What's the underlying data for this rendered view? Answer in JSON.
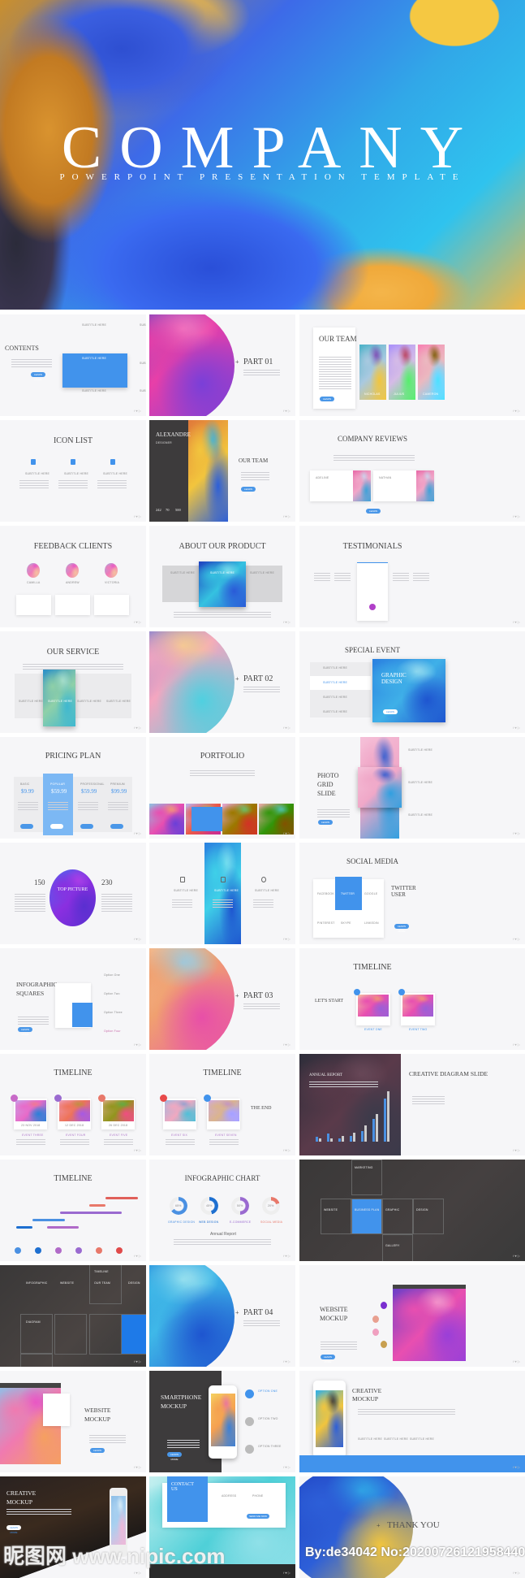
{
  "hero": {
    "title": "COMPANY",
    "subtitle": "POWERPOINT PRESENTATION TEMPLATE"
  },
  "accent": "#4193ec",
  "slides": [
    {
      "title": "CONTENTS",
      "theme": "light",
      "items": [
        "SUBTITLE HERE",
        "SUBTITLE HERE",
        "SUBTITLE HERE",
        "SUBTITLE HERE",
        "SUBTITLE HERE",
        "SUBTITLE HERE"
      ],
      "button": "LEARN MORE"
    },
    {
      "title": "PART 01",
      "theme": "light",
      "palette": [
        "#e83fa8",
        "#7a3fd8",
        "#f27ac2",
        "#3a55d0"
      ]
    },
    {
      "title": "OUR TEAM",
      "theme": "light",
      "items": [
        "NICHOLAS",
        "JULIUS",
        "CAMERON"
      ],
      "button": "LEARN MORE",
      "palette": [
        "#a9c9e0",
        "#f2c53d",
        "#7a3fb0",
        "#4bb2c8"
      ]
    },
    {
      "title": "ICON LIST",
      "theme": "light",
      "items": [
        "SUBTITLE HERE",
        "SUBTITLE HERE",
        "SUBTITLE HERE"
      ]
    },
    {
      "title": "ALEXANDRE",
      "subtitle": "DESIGNER",
      "theme": "light",
      "stats": [
        "242",
        "70",
        "500"
      ],
      "extra": "OUR TEAM",
      "button": "LEARN MORE",
      "palette": [
        "#f2c53d",
        "#2d5fd8",
        "#30b0e8",
        "#e0783a"
      ]
    },
    {
      "title": "COMPANY REVIEWS",
      "theme": "light",
      "items": [
        "ADELINE",
        "NATHAN"
      ],
      "button": "LEARN MORE",
      "palette": [
        "#f0a6c8",
        "#3fa2d8",
        "#c8d8f0",
        "#e86aa8"
      ]
    },
    {
      "title": "FEEDBACK CLIENTS",
      "theme": "light",
      "items": [
        "CAMILLA",
        "ANDREW",
        "VICTORIA"
      ]
    },
    {
      "title": "ABOUT OUR PRODUCT",
      "theme": "light",
      "items": [
        "SUBTITLE HERE",
        "SUBTITLE HERE",
        "SUBTITLE HERE"
      ],
      "palette": [
        "#35c2e0",
        "#2a5ad8",
        "#7fe0ee",
        "#1e40c0"
      ]
    },
    {
      "title": "TESTIMONIALS",
      "theme": "light"
    },
    {
      "title": "OUR SERVICE",
      "theme": "light",
      "items": [
        "SUBTITLE HERE",
        "SUBTITLE HERE",
        "SUBTITLE HERE",
        "SUBTITLE HERE"
      ],
      "palette": [
        "#8fd0a8",
        "#3fb8d0",
        "#a8e0d0",
        "#2a8fc8"
      ]
    },
    {
      "title": "PART 02",
      "theme": "light",
      "palette": [
        "#f4a6c0",
        "#4fd0e0",
        "#f5d08a",
        "#2a6ad8"
      ]
    },
    {
      "title": "SPECIAL EVENT",
      "theme": "light",
      "extra": "GRAPHIC DESIGN",
      "items": [
        "SUBTITLE HERE",
        "SUBTITLE HERE",
        "SUBTITLE HERE",
        "SUBTITLE HERE"
      ],
      "button": "LEARN MORE",
      "palette": [
        "#3fb0e8",
        "#1e55d0",
        "#9fe0f0",
        "#2a80e0"
      ]
    },
    {
      "title": "PRICING PLAN",
      "theme": "light",
      "plans": [
        {
          "name": "BASIC",
          "price": "$9.99"
        },
        {
          "name": "POPULAR",
          "price": "$59.99"
        },
        {
          "name": "PROFESSIONAL",
          "price": "$59.99"
        },
        {
          "name": "PREMIUM",
          "price": "$99.99"
        }
      ]
    },
    {
      "title": "PORTFOLIO",
      "theme": "light",
      "palette": [
        "#e84fb0",
        "#6a3fd8",
        "#f0a070",
        "#8fc0e0"
      ]
    },
    {
      "title": "PHOTO GRID SLIDE",
      "theme": "light",
      "items": [
        "SUBTITLE HERE",
        "SUBTITLE HERE",
        "SUBTITLE HERE"
      ],
      "button": "LEARN MORE",
      "palette": [
        "#f0a8c8",
        "#30a0e0",
        "#1e55d0",
        "#f5c0d8"
      ]
    },
    {
      "title": "TOP PICTURE",
      "theme": "light",
      "stats": [
        "150",
        "230"
      ],
      "palette": [
        "#8a2fe0",
        "#5a2fd0",
        "#b03fe8",
        "#4a6af0"
      ]
    },
    {
      "title": "",
      "theme": "light",
      "items": [
        "SUBTITLE HERE",
        "SUBTITLE HERE",
        "SUBTITLE HERE"
      ],
      "palette": [
        "#3fd0e8",
        "#1e55d0",
        "#7fe0f0",
        "#2a80e0"
      ]
    },
    {
      "title": "SOCIAL MEDIA",
      "theme": "light",
      "extra": "TWITTER USER",
      "items": [
        "FACEBOOK",
        "TWITTER",
        "GOOGLE",
        "PINTEREST",
        "SKYPE",
        "LINKEDIN"
      ],
      "button": "LEARN MORE"
    },
    {
      "title": "INFOGRAPHIC SQUARES",
      "theme": "light",
      "items": [
        "Option One",
        "Option Two",
        "Option Three",
        "Option Four"
      ],
      "button": "LEARN MORE"
    },
    {
      "title": "PART 03",
      "theme": "light",
      "palette": [
        "#f0a070",
        "#e84fa8",
        "#8fd0f0",
        "#f8d8b0"
      ]
    },
    {
      "title": "TIMELINE",
      "theme": "light",
      "extra": "LET'S START",
      "items": [
        "EVENT ONE",
        "EVENT TWO"
      ],
      "palette": [
        "#e84fb0",
        "#9a5fd8",
        "#f0a070",
        "#f5c0a0"
      ]
    },
    {
      "title": "TIMELINE",
      "theme": "light",
      "items": [
        "EVENT THREE",
        "EVENT FOUR",
        "EVENT FIVE"
      ],
      "dates": [
        "23 NOV 2018",
        "12 DEC 2018",
        "26 DEC 2018"
      ],
      "palette": [
        "#e86ac8",
        "#2a80d8",
        "#f07a8a",
        "#c8a0e8"
      ]
    },
    {
      "title": "TIMELINE",
      "theme": "light",
      "extra": "THE END",
      "items": [
        "EVENT SIX",
        "EVENT SEVEN"
      ],
      "palette": [
        "#f0a8c0",
        "#4fc0d8",
        "#8aa0d0",
        "#a0b8e0"
      ]
    },
    {
      "title": "ANNUAL REPORT",
      "theme": "dark",
      "extra": "CREATIVE DIAGRAM SLIDE",
      "palette": [
        "#5a3a4a",
        "#3a3a4a",
        "#6a4a5a",
        "#2e2e3a"
      ]
    },
    {
      "title": "TIMELINE",
      "theme": "light"
    },
    {
      "title": "INFOGRAPHIC CHART",
      "theme": "light",
      "extra": "Annual Report",
      "donuts": [
        {
          "label": "GRAPHIC DESIGN",
          "value": 65,
          "color": "#4a90e2"
        },
        {
          "label": "WEB DESIGN",
          "value": 45,
          "color": "#1e6fd0"
        },
        {
          "label": "E-COMMERCE",
          "value": 50,
          "color": "#9a6ad0"
        },
        {
          "label": "SOCIAL MEDIA",
          "value": 20,
          "color": "#e8786a"
        }
      ]
    },
    {
      "title": "MARKETING",
      "theme": "dark",
      "items": [
        "WEBSITE",
        "BUSINESS PLAN",
        "GRAPHIC",
        "DESIGN",
        "GALLERY"
      ]
    },
    {
      "title": "TIMELINE",
      "theme": "dark",
      "items": [
        "INFOGRAPHIC",
        "WEBSITE",
        "OUR TEAM",
        "DESIGN",
        "DIAGRAM"
      ]
    },
    {
      "title": "PART 04",
      "theme": "light",
      "palette": [
        "#3fb8e8",
        "#1e55d0",
        "#a8e8f0",
        "#2a80d8"
      ]
    },
    {
      "title": "WEBSITE MOCKUP",
      "theme": "light",
      "button": "LEARN MORE",
      "palette": [
        "#e84fb0",
        "#9a3fd8",
        "#f5a0d0",
        "#6a3fc8"
      ]
    },
    {
      "title": "WEBSITE MOCKUP",
      "theme": "light",
      "button": "LEARN MORE",
      "palette": [
        "#f07ab0",
        "#f5a060",
        "#e84fc8",
        "#8fc0e8"
      ]
    },
    {
      "title": "SMARTPHONE MOCKUP",
      "theme": "light",
      "items": [
        "OPTION ONE",
        "OPTION TWO",
        "OPTION THREE"
      ],
      "button": "LEARN MORE",
      "palette": [
        "#f5a050",
        "#3a80d8",
        "#e870a8",
        "#f5d060"
      ]
    },
    {
      "title": "CREATIVE MOCKUP",
      "theme": "light",
      "items": [
        "SUBTITLE HERE",
        "SUBTITLE HERE",
        "SUBTITLE HERE"
      ],
      "palette": [
        "#f2c53d",
        "#2d5fd8",
        "#2e2e3a",
        "#30b0e8"
      ]
    },
    {
      "title": "CREATIVE MOCKUP",
      "theme": "dark",
      "button": "LEARN MORE",
      "palette": [
        "#a8d0f0",
        "#f0b8d8",
        "#e0f0f8",
        "#8fc0e8"
      ]
    },
    {
      "title": "CONTACT US",
      "theme": "light",
      "items": [
        "ADDRESS",
        "PHONE"
      ],
      "button": "SEND ME NOW",
      "palette": [
        "#4fd0d8",
        "#8fe0e8",
        "#2aa0d0",
        "#c8f0f0"
      ]
    },
    {
      "title": "THANK YOU",
      "theme": "light",
      "palette": [
        "#2d5fd8",
        "#f2c53d",
        "#30b0e8",
        "#1e40c0"
      ]
    }
  ],
  "watermark": {
    "site": "昵图网 www.nipic.com",
    "id": "By:de34042 No:20200726121958440"
  }
}
